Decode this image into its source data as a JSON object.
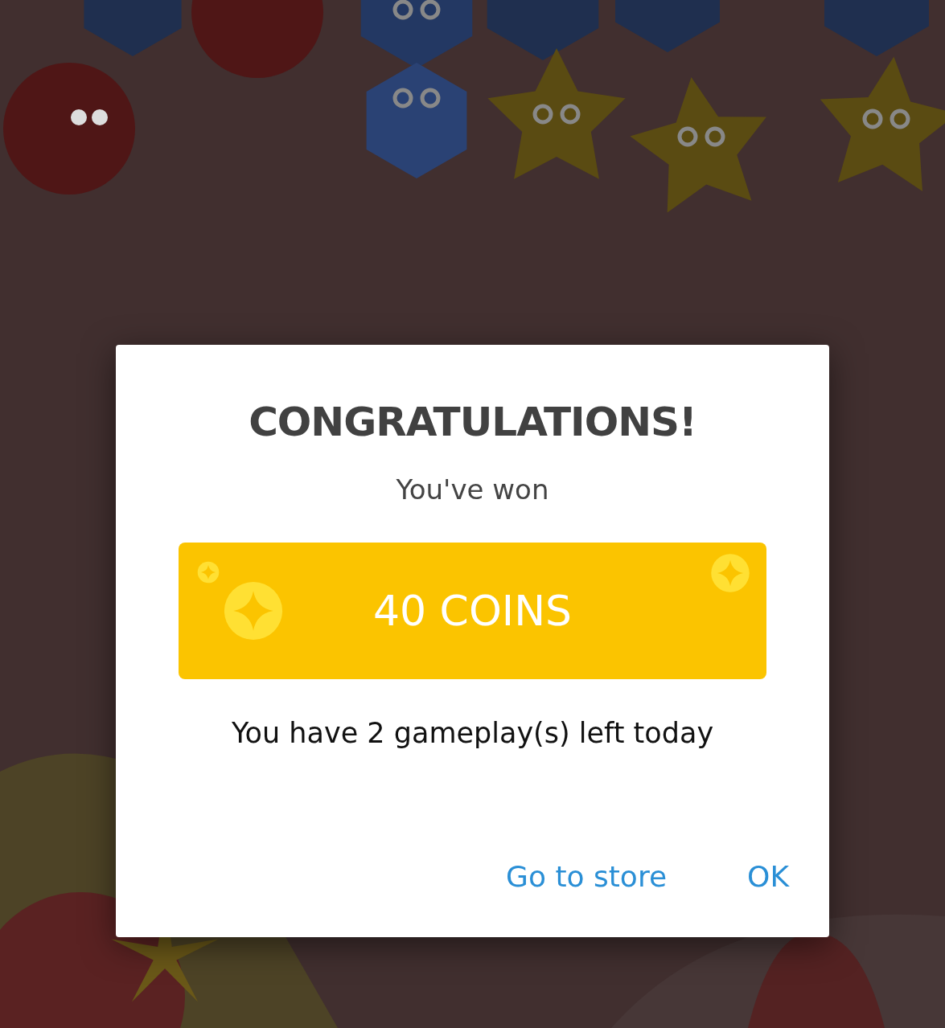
{
  "dialog": {
    "title": "CONGRATULATIONS!",
    "subtitle": "You've won",
    "prize": "40 COINS",
    "remaining": "You have 2 gameplay(s) left today",
    "buttons": [
      "Go to store",
      "OK"
    ]
  }
}
